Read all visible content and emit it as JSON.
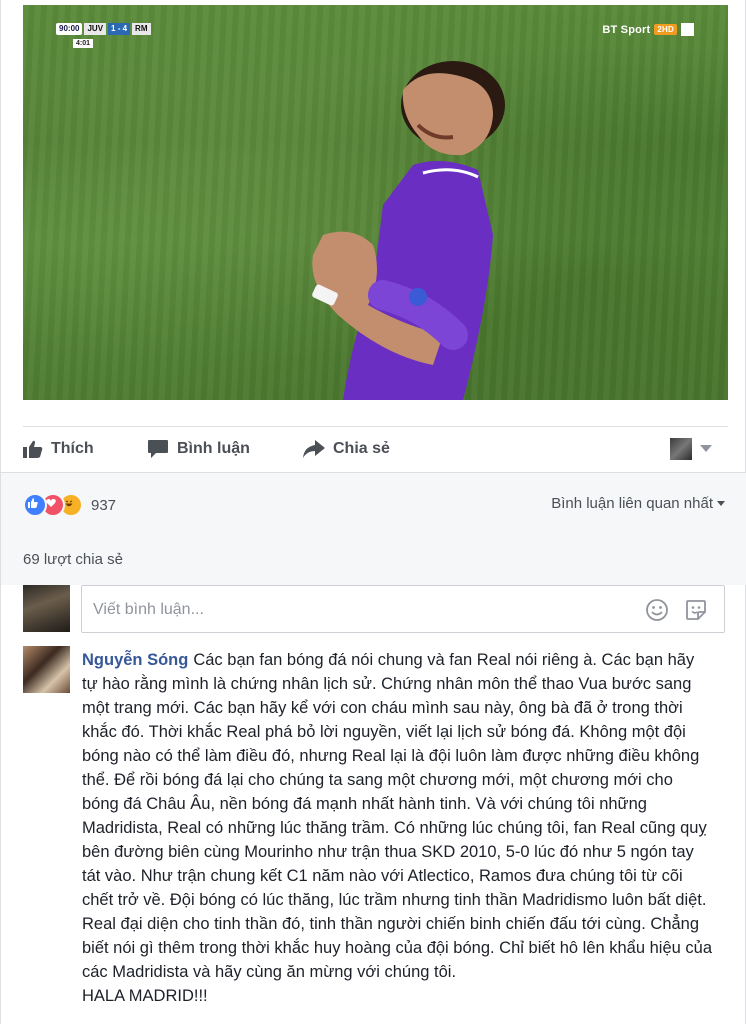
{
  "video": {
    "scorebug": {
      "time": "90:00",
      "home": "JUV",
      "score": "1 - 4",
      "away": "RM",
      "extra": "4:01"
    },
    "broadcaster": "BT Sport",
    "broadcaster_badge": "2HD"
  },
  "actions": {
    "like": "Thích",
    "comment": "Bình luận",
    "share": "Chia sẻ"
  },
  "reactions": {
    "count": "937",
    "types": [
      "like",
      "love",
      "haha"
    ]
  },
  "sort": {
    "label": "Bình luận liên quan nhất"
  },
  "shares": {
    "label": "69 lượt chia sẻ"
  },
  "composer": {
    "placeholder": "Viết bình luận..."
  },
  "comment": {
    "author": "Nguyễn Sóng",
    "text": "Các bạn fan bóng đá nói chung và fan Real nói riêng à. Các bạn hãy tự hào rằng mình là chứng nhân lịch sử. Chứng nhân môn thể thao Vua bước sang một trang mới. Các bạn hãy kể với con cháu mình sau này, ông bà đã ở trong thời khắc đó. Thời khắc Real phá bỏ lời nguyền, viết lại lịch sử bóng đá. Không một đội bóng nào có thể làm điều đó, nhưng Real lại là đội luôn làm được những điều không thể. Để rồi bóng đá lại cho chúng ta sang một chương mới, một chương mới cho bóng đá Châu Âu, nền bóng đá mạnh nhất hành tinh. Và với chúng tôi những Madridista, Real có những lúc thăng trầm. Có những lúc chúng tôi, fan Real cũng quỵ bên đường biên cùng Mourinho như trận thua SKD 2010, 5-0 lúc đó như 5 ngón tay tát vào. Như trận chung kết C1 năm nào với Atlectico, Ramos đưa chúng tôi từ cõi chết trở về. Đội bóng có lúc thăng, lúc trầm nhưng tinh thần Madridismo luôn bất diệt. Real đại diện cho tinh thần đó, tinh thần người chiến binh chiến đấu tới cùng. Chẳng biết nói gì thêm trong thời khắc huy hoàng của đội bóng. Chỉ biết hô lên khẩu hiệu của các Madridista và hãy cùng ăn mừng với chúng tôi.",
    "closing": "HALA MADRID!!!"
  },
  "colors": {
    "link": "#365899",
    "secondary_text": "#4b4f56",
    "like_blue": "#4080ff",
    "love_red": "#f25268",
    "haha_yellow": "#f7b125",
    "pitch_green": "#5a8a3a",
    "kit_purple": "#6a2fc2"
  },
  "icons": {
    "like": "thumbs-up-icon",
    "comment": "speech-bubble-icon",
    "share": "share-arrow-icon",
    "dropdown": "caret-down-icon",
    "emoji": "smiley-icon",
    "sticker": "sticker-icon"
  }
}
